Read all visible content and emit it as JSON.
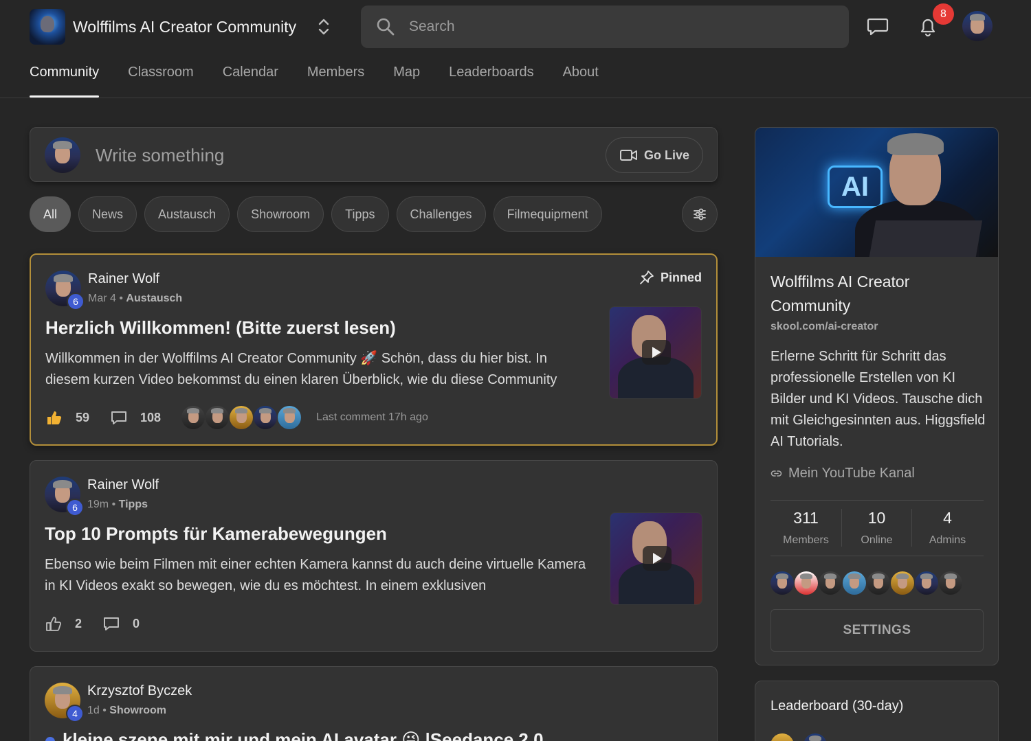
{
  "header": {
    "community_name": "Wolffilms AI Creator Community",
    "search_placeholder": "Search",
    "notification_count": "8"
  },
  "tabs": [
    {
      "label": "Community",
      "active": true
    },
    {
      "label": "Classroom"
    },
    {
      "label": "Calendar"
    },
    {
      "label": "Members"
    },
    {
      "label": "Map"
    },
    {
      "label": "Leaderboards"
    },
    {
      "label": "About"
    }
  ],
  "composer": {
    "placeholder": "Write something",
    "go_live_label": "Go Live"
  },
  "filters": [
    "All",
    "News",
    "Austausch",
    "Showroom",
    "Tipps",
    "Challenges",
    "Filmequipment"
  ],
  "posts": [
    {
      "author": "Rainer Wolf",
      "level": "6",
      "date": "Mar 4",
      "category": "Austausch",
      "pinned_label": "Pinned",
      "title": "Herzlich Willkommen! (Bitte zuerst lesen)",
      "excerpt": "Willkommen in der Wolffilms AI Creator Community 🚀 Schön, dass du hier bist. In diesem kurzen Video bekommst du einen klaren Überblick, wie du diese Community",
      "likes": "59",
      "comments": "108",
      "last_comment": "Last comment 17h ago"
    },
    {
      "author": "Rainer Wolf",
      "level": "6",
      "date": "19m",
      "category": "Tipps",
      "title": "Top 10 Prompts für Kamerabewegungen",
      "excerpt": "Ebenso wie beim Filmen mit einer echten Kamera kannst du auch deine virtuelle Kamera in KI Videos exakt so bewegen, wie du es möchtest. In einem exklusiven",
      "likes": "2",
      "comments": "0"
    },
    {
      "author": "Krzysztof Byczek",
      "level": "4",
      "date": "1d",
      "category": "Showroom",
      "title": "kleine szene mit mir und mein AI avatar 😜 |Seedance 2.0"
    }
  ],
  "sidebar": {
    "title": "Wolffilms AI Creator Community",
    "url": "skool.com/ai-creator",
    "description": "Erlerne Schritt für Schritt das professionelle Erstellen von KI Bilder und KI Videos. Tausche dich mit Gleichgesinnten aus. Higgsfield AI Tutorials.",
    "link_label": "Mein YouTube Kanal",
    "stats": [
      {
        "value": "311",
        "label": "Members"
      },
      {
        "value": "10",
        "label": "Online"
      },
      {
        "value": "4",
        "label": "Admins"
      }
    ],
    "settings_label": "SETTINGS",
    "cover_ai_text": "AI"
  },
  "leaderboard": {
    "title": "Leaderboard (30-day)"
  }
}
